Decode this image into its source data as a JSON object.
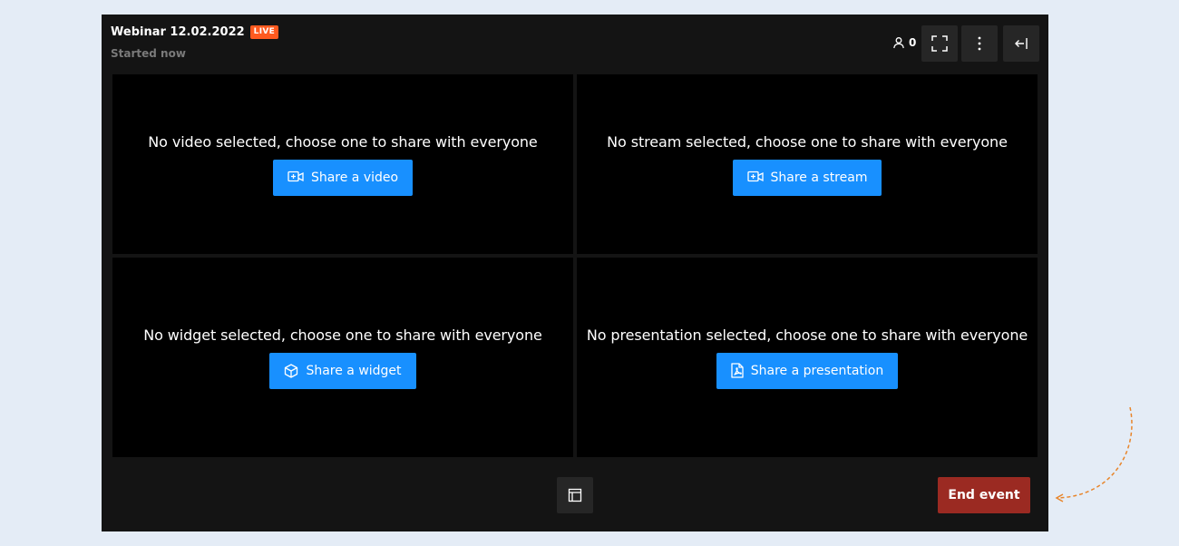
{
  "header": {
    "title": "Webinar 12.02.2022",
    "live_label": "LIVE",
    "subtitle": "Started now",
    "viewer_count": "0"
  },
  "cells": {
    "video": {
      "message": "No video selected, choose one to share with everyone",
      "button": "Share a video",
      "icon": "video-add-icon"
    },
    "stream": {
      "message": "No stream selected, choose one to share with everyone",
      "button": "Share a stream",
      "icon": "video-add-icon"
    },
    "widget": {
      "message": "No widget selected, choose one to share with everyone",
      "button": "Share a widget",
      "icon": "cube-icon"
    },
    "presentation": {
      "message": "No presentation selected, choose one to share with everyone",
      "button": "Share a presentation",
      "icon": "pdf-file-icon"
    }
  },
  "footer": {
    "end_label": "End event"
  },
  "colors": {
    "accent": "#1890ff",
    "live": "#ff5a1f",
    "danger": "#9b2a22",
    "annotation_arrow": "#e8852a"
  }
}
